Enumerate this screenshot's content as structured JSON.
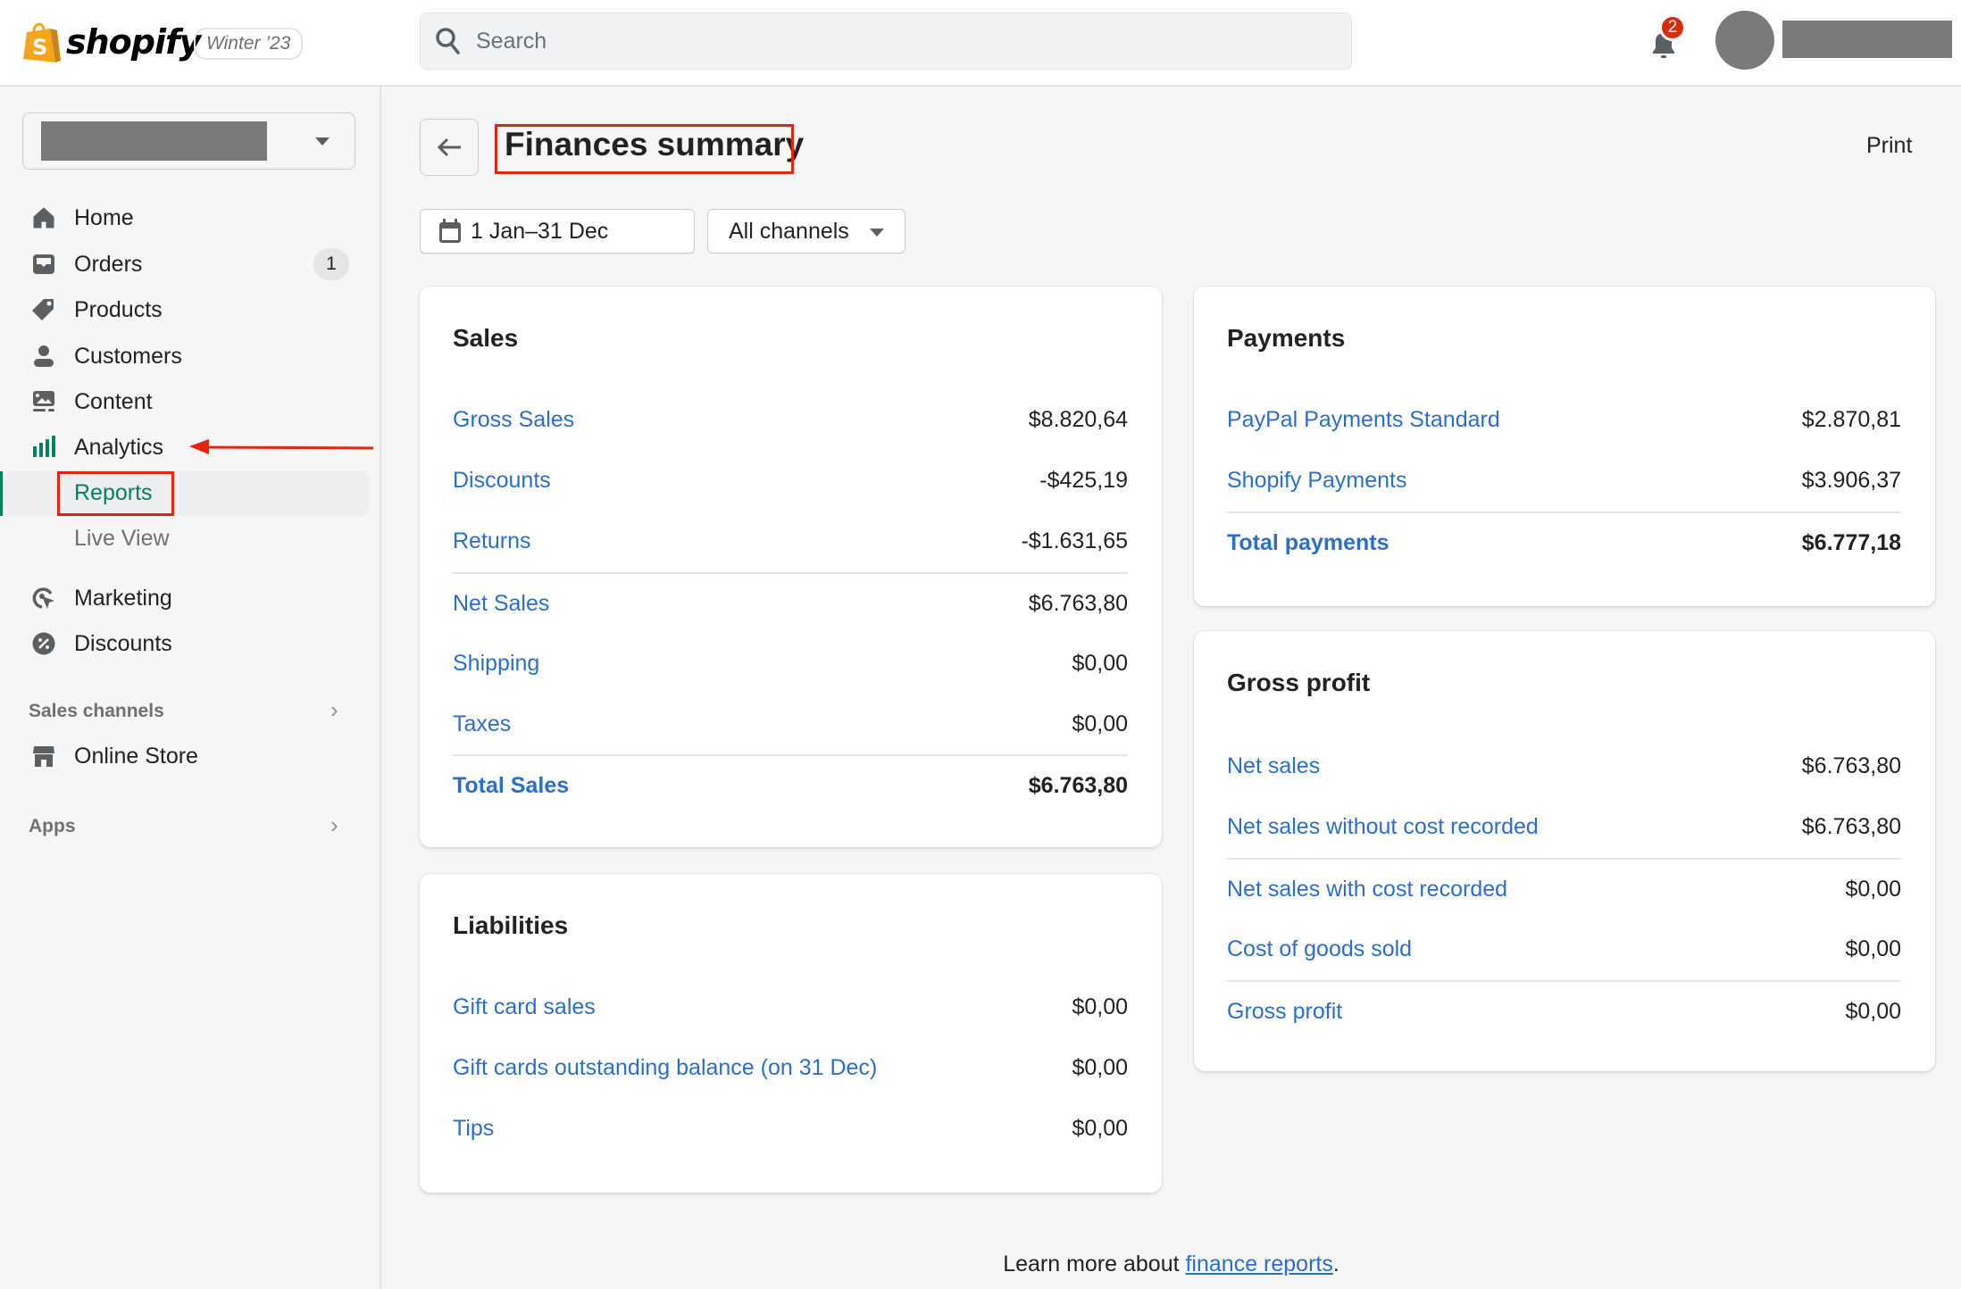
{
  "header": {
    "brand": "shopify",
    "edition": "Winter ’23",
    "search_placeholder": "Search",
    "notification_count": "2"
  },
  "sidebar": {
    "items": [
      {
        "label": "Home",
        "icon": "home-icon"
      },
      {
        "label": "Orders",
        "icon": "orders-icon",
        "badge": "1"
      },
      {
        "label": "Products",
        "icon": "tag-icon"
      },
      {
        "label": "Customers",
        "icon": "person-icon"
      },
      {
        "label": "Content",
        "icon": "content-icon"
      },
      {
        "label": "Analytics",
        "icon": "analytics-icon"
      }
    ],
    "analytics_sub": [
      {
        "label": "Reports",
        "active": true
      },
      {
        "label": "Live View",
        "active": false
      }
    ],
    "items2": [
      {
        "label": "Marketing",
        "icon": "marketing-icon"
      },
      {
        "label": "Discounts",
        "icon": "discount-icon"
      }
    ],
    "sales_channels_label": "Sales channels",
    "online_store_label": "Online Store",
    "apps_label": "Apps"
  },
  "page": {
    "title": "Finances summary",
    "print_label": "Print",
    "date_range": "1 Jan–31 Dec",
    "channel_filter": "All channels"
  },
  "sales": {
    "title": "Sales",
    "rows": [
      {
        "label": "Gross Sales",
        "value": "$8.820,64"
      },
      {
        "label": "Discounts",
        "value": "-$425,19"
      },
      {
        "label": "Returns",
        "value": "-$1.631,65"
      },
      {
        "label": "Net Sales",
        "value": "$6.763,80"
      },
      {
        "label": "Shipping",
        "value": "$0,00"
      },
      {
        "label": "Taxes",
        "value": "$0,00"
      },
      {
        "label": "Total Sales",
        "value": "$6.763,80"
      }
    ]
  },
  "liabilities": {
    "title": "Liabilities",
    "rows": [
      {
        "label": "Gift card sales",
        "value": "$0,00"
      },
      {
        "label": "Gift cards outstanding balance (on 31 Dec)",
        "value": "$0,00"
      },
      {
        "label": "Tips",
        "value": "$0,00"
      }
    ]
  },
  "payments": {
    "title": "Payments",
    "rows": [
      {
        "label": "PayPal Payments Standard",
        "value": "$2.870,81"
      },
      {
        "label": "Shopify Payments",
        "value": "$3.906,37"
      },
      {
        "label": "Total payments",
        "value": "$6.777,18"
      }
    ]
  },
  "gross_profit": {
    "title": "Gross profit",
    "rows": [
      {
        "label": "Net sales",
        "value": "$6.763,80"
      },
      {
        "label": "Net sales without cost recorded",
        "value": "$6.763,80"
      },
      {
        "label": "Net sales with cost recorded",
        "value": "$0,00"
      },
      {
        "label": "Cost of goods sold",
        "value": "$0,00"
      },
      {
        "label": "Gross profit",
        "value": "$0,00"
      }
    ]
  },
  "footer": {
    "prefix": "Learn more about ",
    "link": "finance reports",
    "suffix": "."
  },
  "colors": {
    "link": "#2c6ecb",
    "accent_green": "#008060",
    "annotation_red": "#e8220d",
    "badge_red": "#d82c0d"
  }
}
